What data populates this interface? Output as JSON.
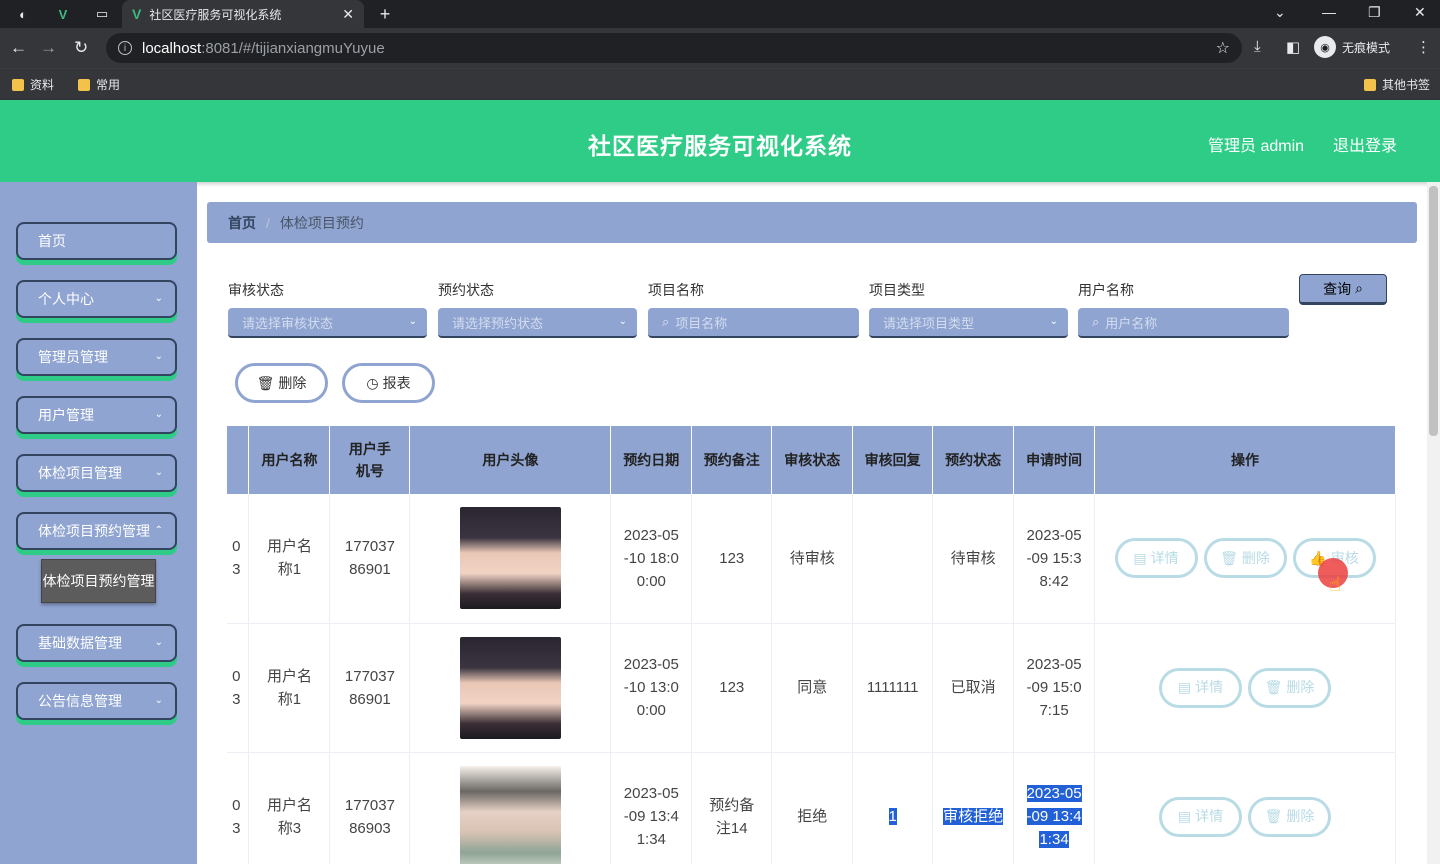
{
  "browser": {
    "tab_title": "社区医疗服务可视化系统",
    "url_host": "localhost",
    "url_path": ":8081/#/tijianxiangmuYuyue",
    "incognito_label": "无痕模式",
    "bookmarks": [
      "资料",
      "常用"
    ],
    "other_bookmarks": "其他书签"
  },
  "header": {
    "title": "社区医疗服务可视化系统",
    "user": "管理员 admin",
    "logout": "退出登录"
  },
  "sidebar": {
    "items": [
      {
        "label": "首页",
        "has_arrow": false
      },
      {
        "label": "个人中心",
        "has_arrow": true
      },
      {
        "label": "管理员管理",
        "has_arrow": true
      },
      {
        "label": "用户管理",
        "has_arrow": true
      },
      {
        "label": "体检项目管理",
        "has_arrow": true
      },
      {
        "label": "体检项目预约管理",
        "has_arrow": true
      },
      {
        "label": "基础数据管理",
        "has_arrow": true
      },
      {
        "label": "公告信息管理",
        "has_arrow": true
      }
    ],
    "active_sub": "体检项目预约管理"
  },
  "breadcrumb": {
    "home": "首页",
    "separator": "/",
    "current": "体检项目预约"
  },
  "filters": {
    "audit_status": {
      "label": "审核状态",
      "placeholder": "请选择审核状态"
    },
    "booking_status": {
      "label": "预约状态",
      "placeholder": "请选择预约状态"
    },
    "project_name": {
      "label": "项目名称",
      "placeholder": "项目名称"
    },
    "project_type": {
      "label": "项目类型",
      "placeholder": "请选择项目类型"
    },
    "user_name": {
      "label": "用户名称",
      "placeholder": "用户名称"
    },
    "query_button": "查询"
  },
  "actions": {
    "delete": "删除",
    "report": "报表"
  },
  "table": {
    "headers": [
      "",
      "用户名称",
      "用户手机号",
      "用户头像",
      "预约日期",
      "预约备注",
      "审核状态",
      "审核回复",
      "预约状态",
      "申请时间",
      "操作"
    ],
    "rows": [
      {
        "cut": "0\n3",
        "user": "用户名称1",
        "phone": "17703786901",
        "date": "2023-05-10 18:00:00",
        "note": "123",
        "audit": "待审核",
        "reply": "",
        "status": "待审核",
        "applied": "2023-05-09 15:38:42",
        "buttons": [
          "详情",
          "删除",
          "审核"
        ]
      },
      {
        "cut": "0\n3",
        "user": "用户名称1",
        "phone": "17703786901",
        "date": "2023-05-10 13:00:00",
        "note": "123",
        "audit": "同意",
        "reply": "1111111",
        "status": "已取消",
        "applied": "2023-05-09 15:07:15",
        "buttons": [
          "详情",
          "删除"
        ]
      },
      {
        "cut": "0\n3",
        "user": "用户名称3",
        "phone": "17703786903",
        "date": "2023-05-09 13:41:34",
        "note": "预约备注14",
        "audit": "拒绝",
        "reply": "1",
        "status": "审核拒绝",
        "applied": "2023-05-09 13:41:34",
        "buttons": [
          "详情",
          "删除"
        ]
      }
    ]
  }
}
